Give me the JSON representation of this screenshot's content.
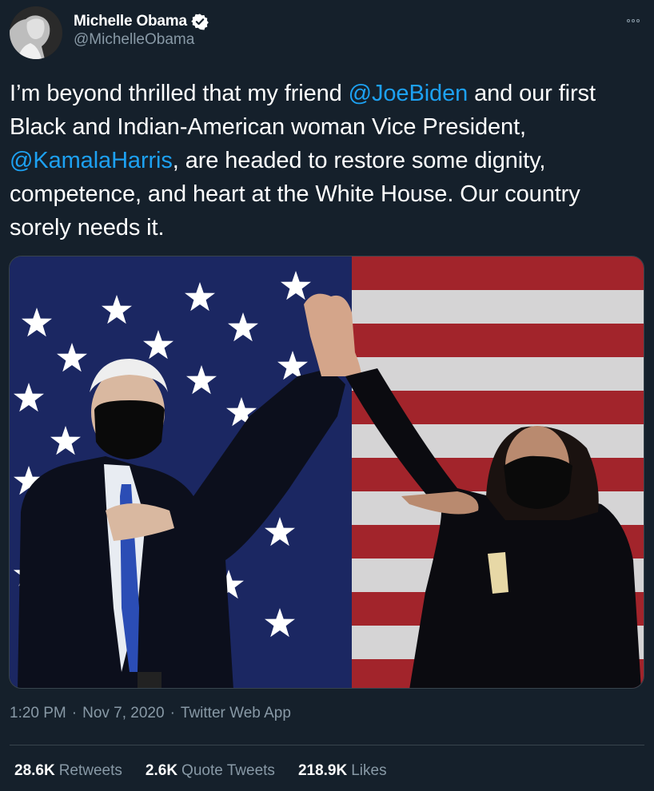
{
  "author": {
    "display_name": "Michelle Obama",
    "handle": "@MichelleObama",
    "verified": true
  },
  "tweet": {
    "segments": [
      {
        "text": "I’m beyond thrilled that my friend ",
        "type": "text"
      },
      {
        "text": "@JoeBiden",
        "type": "mention"
      },
      {
        "text": " and our first Black and Indian-American woman Vice President, ",
        "type": "text"
      },
      {
        "text": "@KamalaHarris",
        "type": "mention"
      },
      {
        "text": ", are headed to restore some dignity, competence, and heart at the White House. Our country sorely needs it.",
        "type": "text"
      }
    ]
  },
  "meta": {
    "time": "1:20 PM",
    "date": "Nov 7, 2020",
    "source": "Twitter Web App",
    "separator": "·"
  },
  "stats": {
    "retweets_count": "28.6K",
    "retweets_label": "Retweets",
    "quotes_count": "2.6K",
    "quotes_label": "Quote Tweets",
    "likes_count": "218.9K",
    "likes_label": "Likes"
  },
  "colors": {
    "background": "#15202b",
    "mention": "#1da1f2",
    "secondary_text": "#8899a6",
    "verified_badge": "#ffffff"
  },
  "icons": {
    "verified": "verified-badge-icon",
    "more": "more-options-icon"
  }
}
